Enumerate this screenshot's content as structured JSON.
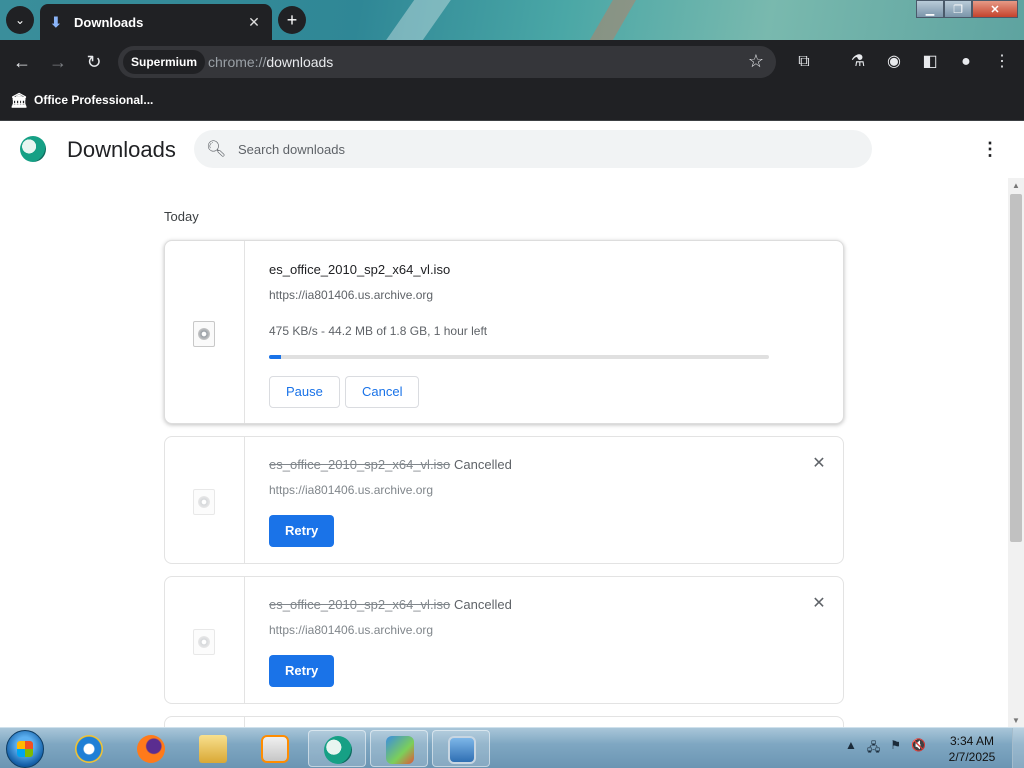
{
  "tab": {
    "title": "Downloads",
    "close_glyph": "✕"
  },
  "toolbar": {
    "chip_label": "Supermium",
    "url_scheme": "chrome://",
    "url_host": "downloads"
  },
  "bookmarks": [
    {
      "label": "Office Professional..."
    }
  ],
  "page": {
    "title": "Downloads",
    "search_placeholder": "Search downloads",
    "section_label": "Today"
  },
  "downloads": [
    {
      "filename": "es_office_2010_sp2_x64_vl.iso",
      "source": "https://ia801406.us.archive.org",
      "progress_text": "475 KB/s - 44.2 MB of 1.8 GB, 1 hour left",
      "progress_percent": 2.4,
      "actions": [
        "Pause",
        "Cancel"
      ],
      "state": "in_progress"
    },
    {
      "filename": "es_office_2010_sp2_x64_vl.iso",
      "status": "Cancelled",
      "source": "https://ia801406.us.archive.org",
      "action": "Retry",
      "state": "cancelled"
    },
    {
      "filename": "es_office_2010_sp2_x64_vl.iso",
      "status": "Cancelled",
      "source": "https://ia801406.us.archive.org",
      "action": "Retry",
      "state": "cancelled"
    }
  ],
  "taskbar": {
    "clock_time": "3:34 AM",
    "clock_date": "2/7/2025",
    "apps": [
      "internet-explorer-icon",
      "firefox-icon",
      "file-explorer-icon",
      "media-player-icon",
      "supermium-icon",
      "network-people-icon",
      "display-settings-icon"
    ]
  },
  "colors": {
    "accent": "#1a73e8",
    "chrome_dark": "#202124"
  }
}
